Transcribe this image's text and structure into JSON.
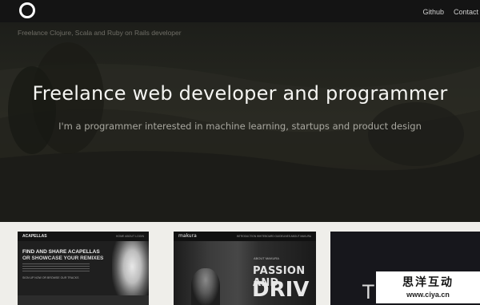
{
  "nav": {
    "links": [
      "Github",
      "Contact"
    ]
  },
  "hero": {
    "tagline": "Freelance Clojure, Scala and Ruby on Rails developer",
    "title": "Freelance web developer and programmer",
    "subtitle": "I'm a programmer interested in machine learning, startups and product design"
  },
  "thumbs": {
    "acapellas": {
      "brand": "ACAPELLAS",
      "menu": "HOME  ABOUT  LOGIN",
      "headline_1": "FIND AND SHARE ACAPELLAS",
      "headline_2": "OR SHOWCASE YOUR REMIXES",
      "signup": "SIGN UP NOW OR BROWSE OUR TRACKS"
    },
    "makura": {
      "brand": "makura",
      "menu": "INTRODUCTION  WHITEBOARD  GUIDELINES  ABOUT MAKURA",
      "label": "ABOUT MAKURA",
      "big_1": "PASSION AND",
      "big_2": "DRIV"
    },
    "third": {
      "text": "T"
    }
  },
  "watermark": {
    "cn": "思洋互动",
    "url": "www.ciya.cn"
  }
}
